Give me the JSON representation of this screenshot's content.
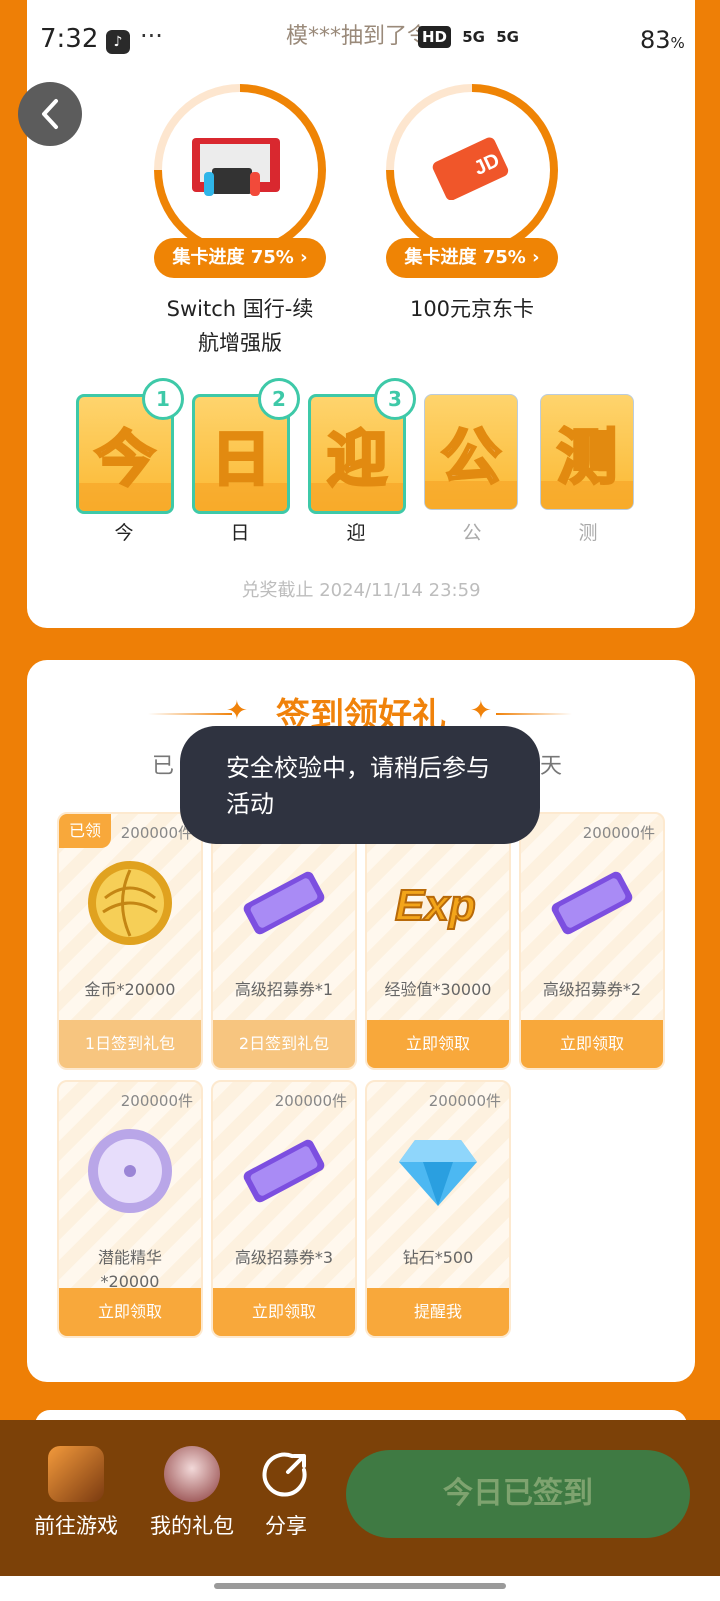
{
  "status_bar": {
    "time": "7:32",
    "more": "···",
    "marquee": "模***抽到了令",
    "hd": "HD",
    "net1": "5G",
    "net2": "5G",
    "battery": "83",
    "battery_unit": "%"
  },
  "prizes": [
    {
      "progress_label": "集卡进度 75% ›",
      "progress": 0.75,
      "name": "Switch 国行-续航增强版",
      "name_line1": "Switch 国行-续",
      "name_line2": "航增强版"
    },
    {
      "progress_label": "集卡进度 75% ›",
      "progress": 0.75,
      "name": "100元京东卡"
    }
  ],
  "letters": [
    {
      "char": "今",
      "label": "今",
      "badge": "1",
      "collected": true
    },
    {
      "char": "日",
      "label": "日",
      "badge": "2",
      "collected": true
    },
    {
      "char": "迎",
      "label": "迎",
      "badge": "3",
      "collected": true
    },
    {
      "char": "公",
      "label": "公",
      "collected": false
    },
    {
      "char": "测",
      "label": "测",
      "collected": false
    }
  ],
  "deadline": "兑奖截止 2024/11/14 23:59",
  "signin": {
    "title": "签到领好礼",
    "subtitle_left": "已",
    "subtitle_right": "天",
    "toast": "安全校验中，请稍后参与活动",
    "rewards": [
      {
        "count": "200000件",
        "name": "金币*20000",
        "button": "1日签到礼包",
        "tag": "已领",
        "icon": "gold-coin-icon"
      },
      {
        "count": "",
        "name": "高级招募券*1",
        "button": "2日签到礼包",
        "icon": "ticket-icon"
      },
      {
        "count": "",
        "name": "经验值*30000",
        "button": "立即领取",
        "icon": "exp-icon"
      },
      {
        "count": "200000件",
        "name": "高级招募券*2",
        "button": "立即领取",
        "icon": "ticket-icon"
      },
      {
        "count": "200000件",
        "name": "潜能精华",
        "name2": "*20000",
        "button": "立即领取",
        "icon": "potential-essence-icon"
      },
      {
        "count": "200000件",
        "name": "高级招募券*3",
        "button": "立即领取",
        "icon": "ticket-icon"
      },
      {
        "count": "200000件",
        "name": "钻石*500",
        "button": "提醒我",
        "icon": "diamond-icon"
      }
    ]
  },
  "bottom_nav": {
    "go_game": "前往游戏",
    "my_gifts": "我的礼包",
    "share": "分享",
    "signed_button": "今日已签到"
  },
  "colors": {
    "accent": "#ef8405",
    "teal": "#3ec9a8",
    "nav_bg": "#7c4108",
    "signed_bg": "#3f7a43"
  }
}
